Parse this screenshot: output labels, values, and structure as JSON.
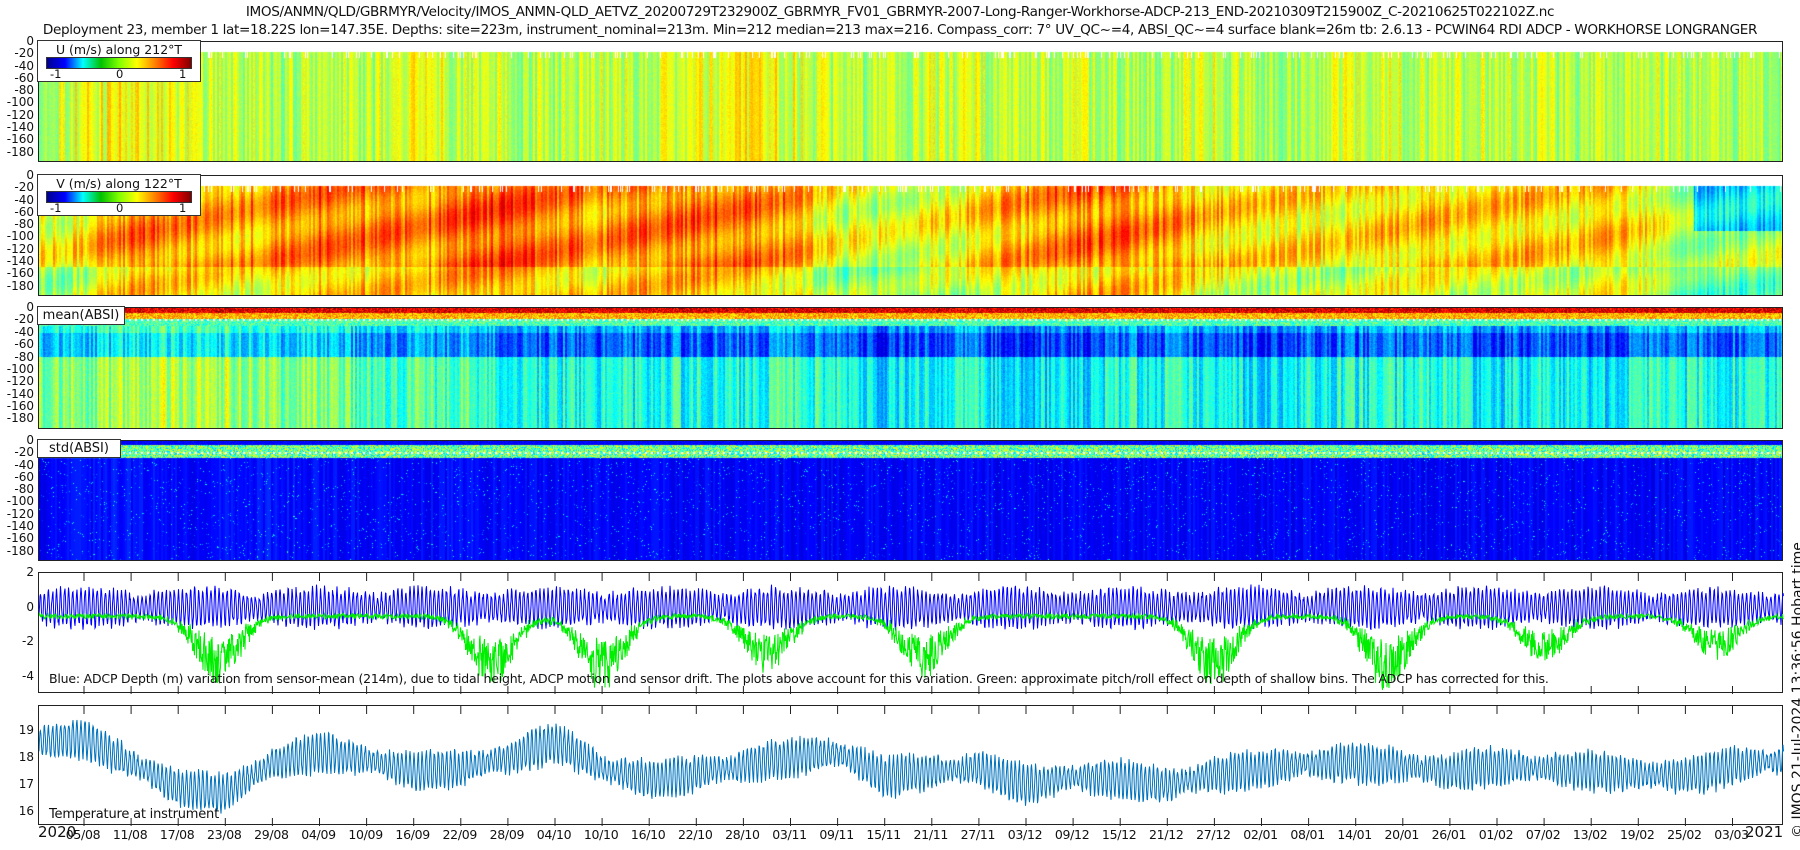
{
  "title": {
    "line1": "IMOS/ANMN/QLD/GBRMYR/Velocity/IMOS_ANMN-QLD_AETVZ_20200729T232900Z_GBRMYR_FV01_GBRMYR-2007-Long-Ranger-Workhorse-ADCP-213_END-20210309T215900Z_C-20210625T022102Z.nc",
    "line2": "Deployment 23, member 1 lat=18.22S lon=147.35E. Depths: site=223m, instrument_nominal=213m. Min=212 median=213 max=216. Compass_corr: 7° UV_QC~=4, ABSI_QC~=4 surface blank=26m tb: 2.6.13 - PCWIN64 RDI ADCP - WORKHORSE LONGRANGER"
  },
  "side_label": "© IMOS 21-Jul-2024 13:36:56 Hobart time",
  "x_axis": {
    "start_date": "2020-07-29",
    "end_date": "2021-03-09",
    "year_start_label": "2020",
    "year_end_label": "2021",
    "tick_labels": [
      "05/08",
      "11/08",
      "17/08",
      "23/08",
      "29/08",
      "04/09",
      "10/09",
      "16/09",
      "22/09",
      "28/09",
      "04/10",
      "10/10",
      "16/10",
      "22/10",
      "28/10",
      "03/11",
      "09/11",
      "15/11",
      "21/11",
      "27/11",
      "03/12",
      "09/12",
      "15/12",
      "21/12",
      "27/12",
      "02/01",
      "08/01",
      "14/01",
      "20/01",
      "26/01",
      "01/02",
      "07/02",
      "13/02",
      "19/02",
      "25/02",
      "03/03"
    ]
  },
  "heatmap_yticks": [
    "0",
    "-20",
    "-40",
    "-60",
    "-80",
    "-100",
    "-120",
    "-140",
    "-160",
    "-180"
  ],
  "chart_data": [
    {
      "type": "heatmap",
      "legend_title": "U (m/s) along 212°T",
      "colorbar_ticks": [
        "-1",
        "0",
        "1"
      ],
      "clim": [
        -1,
        1
      ],
      "colormap": "jet",
      "ylim": [
        -197,
        0
      ],
      "typical_level_by_tick_period": [
        0.15,
        0.2,
        0.25,
        0.2,
        0.15,
        0.1,
        0.15,
        0.1,
        0.2,
        0.15,
        0.1,
        0.1,
        0.15,
        0.15,
        0.2,
        0.25,
        0.2,
        0.1,
        0.1,
        0.15,
        0.15,
        0.1,
        0.15,
        0.1,
        0.1,
        0.15,
        0.1,
        0.1,
        0.15,
        0.15,
        0.1,
        0.15,
        0.1,
        0.1,
        0.15,
        0.1,
        0.1
      ]
    },
    {
      "type": "heatmap",
      "legend_title": "V (m/s) along 122°T",
      "colorbar_ticks": [
        "-1",
        "0",
        "1"
      ],
      "clim": [
        -1,
        1
      ],
      "colormap": "jet",
      "ylim": [
        -197,
        0
      ],
      "typical_level_by_tick_period": [
        0.2,
        0.3,
        0.5,
        0.45,
        0.4,
        0.5,
        0.55,
        0.5,
        0.45,
        0.55,
        0.6,
        0.5,
        0.45,
        0.5,
        0.55,
        0.5,
        0.45,
        0.2,
        0.15,
        0.25,
        0.3,
        0.45,
        0.5,
        0.5,
        0.45,
        0.35,
        0.3,
        0.25,
        0.3,
        0.35,
        0.3,
        0.35,
        0.3,
        0.3,
        0.3,
        0.0,
        0.1
      ]
    },
    {
      "type": "heatmap",
      "legend_title": "mean(ABSI)",
      "colormap": "jet",
      "ylim": [
        -197,
        0
      ],
      "typical_level_by_tick_period": [
        0.45,
        0.45,
        0.5,
        0.5,
        0.5,
        0.45,
        0.45,
        0.4,
        0.4,
        0.4,
        0.35,
        0.35,
        0.35,
        0.35,
        0.35,
        0.35,
        0.4,
        0.35,
        0.3,
        0.35,
        0.35,
        0.3,
        0.3,
        0.35,
        0.35,
        0.35,
        0.3,
        0.35,
        0.35,
        0.35,
        0.35,
        0.3,
        0.35,
        0.3,
        0.35,
        0.35,
        0.35
      ]
    },
    {
      "type": "heatmap",
      "legend_title": "std(ABSI)",
      "colormap": "jet",
      "ylim": [
        -197,
        0
      ],
      "typical_level_by_tick_period": [
        0.12,
        0.13,
        0.14,
        0.13,
        0.13,
        0.14,
        0.13,
        0.12,
        0.12,
        0.13,
        0.12,
        0.12,
        0.12,
        0.12,
        0.12,
        0.12,
        0.12,
        0.12,
        0.12,
        0.12,
        0.12,
        0.12,
        0.12,
        0.12,
        0.12,
        0.12,
        0.12,
        0.12,
        0.12,
        0.12,
        0.12,
        0.12,
        0.12,
        0.12,
        0.12,
        0.12,
        0.12
      ]
    },
    {
      "type": "line",
      "ylim": [
        -5,
        2
      ],
      "yticks": [
        "2",
        "0",
        "-2",
        "-4"
      ],
      "annotation": "Blue: ADCP Depth (m) variation from sensor-mean (214m), due to tidal height, ADCP motion and sensor drift. The plots above account for this variation. Green: approximate pitch/roll effect on depth of shallow bins. The ADCP has corrected for this.",
      "series": [
        {
          "color": "#0000ff",
          "mean": 0,
          "tidal_amplitude": 1.1
        },
        {
          "color": "#00ee00",
          "baseline": -0.5,
          "dip_dates": [
            "2020-08-22",
            "2020-09-26",
            "2020-10-10",
            "2020-10-31",
            "2020-11-20",
            "2020-12-27",
            "2021-01-18",
            "2021-02-07",
            "2021-03-01"
          ],
          "dip_depths": [
            -4.5,
            -4.6,
            -4.8,
            -3.8,
            -4.0,
            -4.6,
            -4.8,
            -3.2,
            -3.0
          ]
        }
      ]
    },
    {
      "type": "line",
      "ylim": [
        15.5,
        19.9
      ],
      "yticks": [
        "19",
        "18",
        "17",
        "16"
      ],
      "annotation": "Temperature at instrument",
      "series": [
        {
          "color": "#0072bd",
          "x": [
            "2020-07-30",
            "2020-08-05",
            "2020-08-11",
            "2020-08-17",
            "2020-08-23",
            "2020-08-29",
            "2020-09-04",
            "2020-09-10",
            "2020-09-16",
            "2020-09-22",
            "2020-09-28",
            "2020-10-04",
            "2020-10-10",
            "2020-10-16",
            "2020-10-22",
            "2020-10-28",
            "2020-11-03",
            "2020-11-09",
            "2020-11-15",
            "2020-11-21",
            "2020-11-27",
            "2020-12-03",
            "2020-12-09",
            "2020-12-15",
            "2020-12-21",
            "2020-12-27",
            "2021-01-02",
            "2021-01-08",
            "2021-01-14",
            "2021-01-20",
            "2021-01-26",
            "2021-02-01",
            "2021-02-07",
            "2021-02-13",
            "2021-02-19",
            "2021-02-25",
            "2021-03-03",
            "2021-03-09"
          ],
          "y": [
            18.6,
            18.7,
            17.8,
            16.9,
            16.7,
            17.8,
            18.2,
            17.9,
            17.5,
            17.6,
            18.0,
            18.6,
            17.6,
            17.2,
            17.4,
            17.7,
            18.0,
            18.2,
            17.3,
            17.5,
            17.6,
            17.0,
            17.3,
            17.2,
            17.0,
            17.4,
            17.6,
            17.8,
            17.8,
            17.7,
            17.5,
            17.7,
            17.6,
            17.5,
            17.4,
            17.3,
            17.7,
            17.9
          ],
          "tidal_amplitude": 0.7
        }
      ]
    }
  ]
}
